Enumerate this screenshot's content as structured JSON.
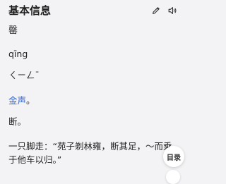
{
  "header": {
    "title": "基本信息",
    "edit_icon": "pencil-icon",
    "speaker_icon": "speaker-icon"
  },
  "entry": {
    "character": "罄",
    "pinyin": "qīng",
    "zhuyin": "ㄑㄧㄥˉ",
    "radical_link": "金声",
    "radical_suffix": "。",
    "definition": "断。",
    "example_line1": "一只脚走：“苑子剃林雍，断其足，～而乘",
    "example_line2": "于他车以归。”"
  },
  "toc_button": {
    "label": "目录"
  },
  "colors": {
    "background": "#f3f3f6",
    "link": "#3a66c6"
  }
}
